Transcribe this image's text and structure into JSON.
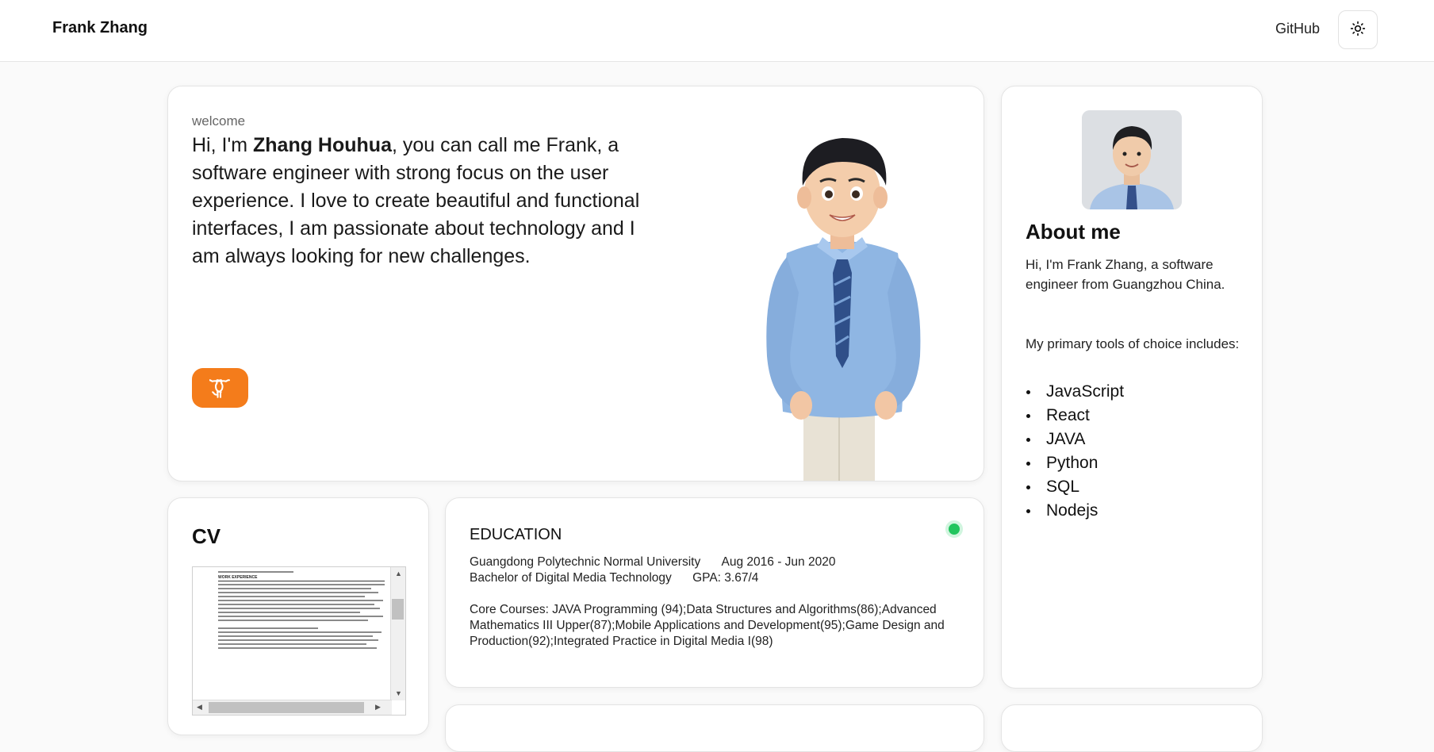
{
  "header": {
    "brand": "Frank Zhang",
    "github_label": "GitHub",
    "theme_icon": "sun-icon"
  },
  "hero": {
    "eyebrow": "welcome",
    "intro_prefix": "Hi, I'm ",
    "intro_name": "Zhang Houhua",
    "intro_suffix": ", you can call me Frank, a software engineer with strong focus on the user experience. I love to create beautiful and functional interfaces, I am passionate about technology and I am always looking for new challenges.",
    "github_button_icon": "github-icon",
    "accent": "#f47c1b"
  },
  "about": {
    "title": "About me",
    "bio": "Hi, I'm Frank Zhang, a software engineer from Guangzhou China.",
    "tools_intro": "My primary tools of choice includes:",
    "tools": [
      "JavaScript",
      "React",
      "JAVA",
      "Python",
      "SQL",
      "Nodejs"
    ]
  },
  "cv": {
    "title": "CV",
    "doc_heading": "WORK EXPERIENCE"
  },
  "education": {
    "title": "EDUCATION",
    "school": "Guangdong Polytechnic Normal University",
    "dates": "Aug 2016 - Jun 2020",
    "degree": "Bachelor of Digital Media Technology",
    "gpa": "GPA: 3.67/4",
    "courses": "Core Courses: JAVA Programming (94);Data Structures and Algorithms(86);Advanced Mathematics III Upper(87);Mobile Applications and Development(95);Game Design and Production(92);Integrated Practice in Digital Media I(98)",
    "status_color": "#22c55e"
  }
}
